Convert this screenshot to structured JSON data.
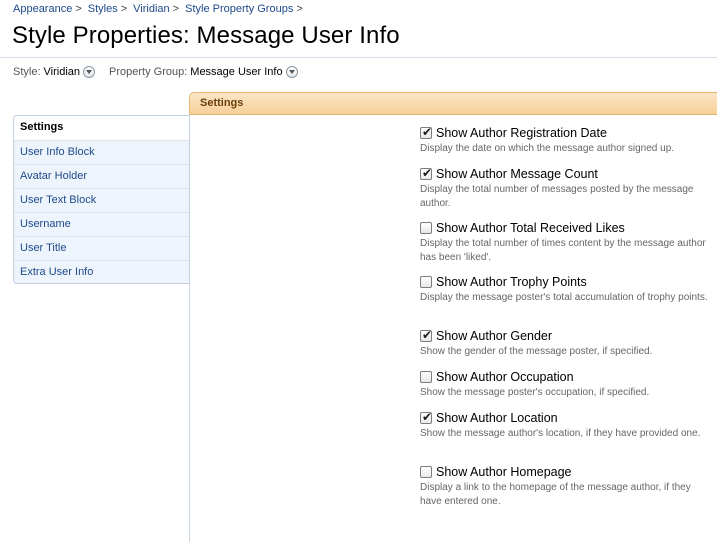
{
  "breadcrumb": {
    "items": [
      "Appearance",
      "Styles",
      "Viridian",
      "Style Property Groups"
    ],
    "separator": ">"
  },
  "page": {
    "title": "Style Properties: Message User Info"
  },
  "filters": {
    "style_label": "Style:",
    "style_value": "Viridian",
    "group_label": "Property Group:",
    "group_value": "Message User Info"
  },
  "tab_header": {
    "label": "Settings"
  },
  "sidebar": {
    "items": [
      {
        "label": "Settings",
        "active": true
      },
      {
        "label": "User Info Block",
        "active": false
      },
      {
        "label": "Avatar Holder",
        "active": false
      },
      {
        "label": "User Text Block",
        "active": false
      },
      {
        "label": "Username",
        "active": false
      },
      {
        "label": "User Title",
        "active": false
      },
      {
        "label": "Extra User Info",
        "active": false
      }
    ]
  },
  "settings": {
    "options": [
      {
        "label": "Show Author Registration Date",
        "checked": true,
        "description": "Display the date on which the message author signed up."
      },
      {
        "label": "Show Author Message Count",
        "checked": true,
        "description": "Display the total number of messages posted by the message author."
      },
      {
        "label": "Show Author Total Received Likes",
        "checked": false,
        "description": "Display the total number of times content by the message author has been 'liked'."
      },
      {
        "label": "Show Author Trophy Points",
        "checked": false,
        "description": "Display the message poster's total accumulation of trophy points."
      },
      {
        "label": "Show Author Gender",
        "checked": true,
        "description": "Show the gender of the message poster, if specified."
      },
      {
        "label": "Show Author Occupation",
        "checked": false,
        "description": "Show the message poster's occupation, if specified."
      },
      {
        "label": "Show Author Location",
        "checked": true,
        "description": "Show the message author's location, if they have provided one."
      },
      {
        "label": "Show Author Homepage",
        "checked": false,
        "description": "Display a link to the homepage of the message author, if they have entered one."
      }
    ]
  },
  "colors": {
    "link": "#1e4a8a",
    "tab_header_bg": "#f6cf97",
    "tab_header_text": "#6b3f0c",
    "sidebar_bg": "#eef4fb",
    "description_text": "#666666"
  }
}
